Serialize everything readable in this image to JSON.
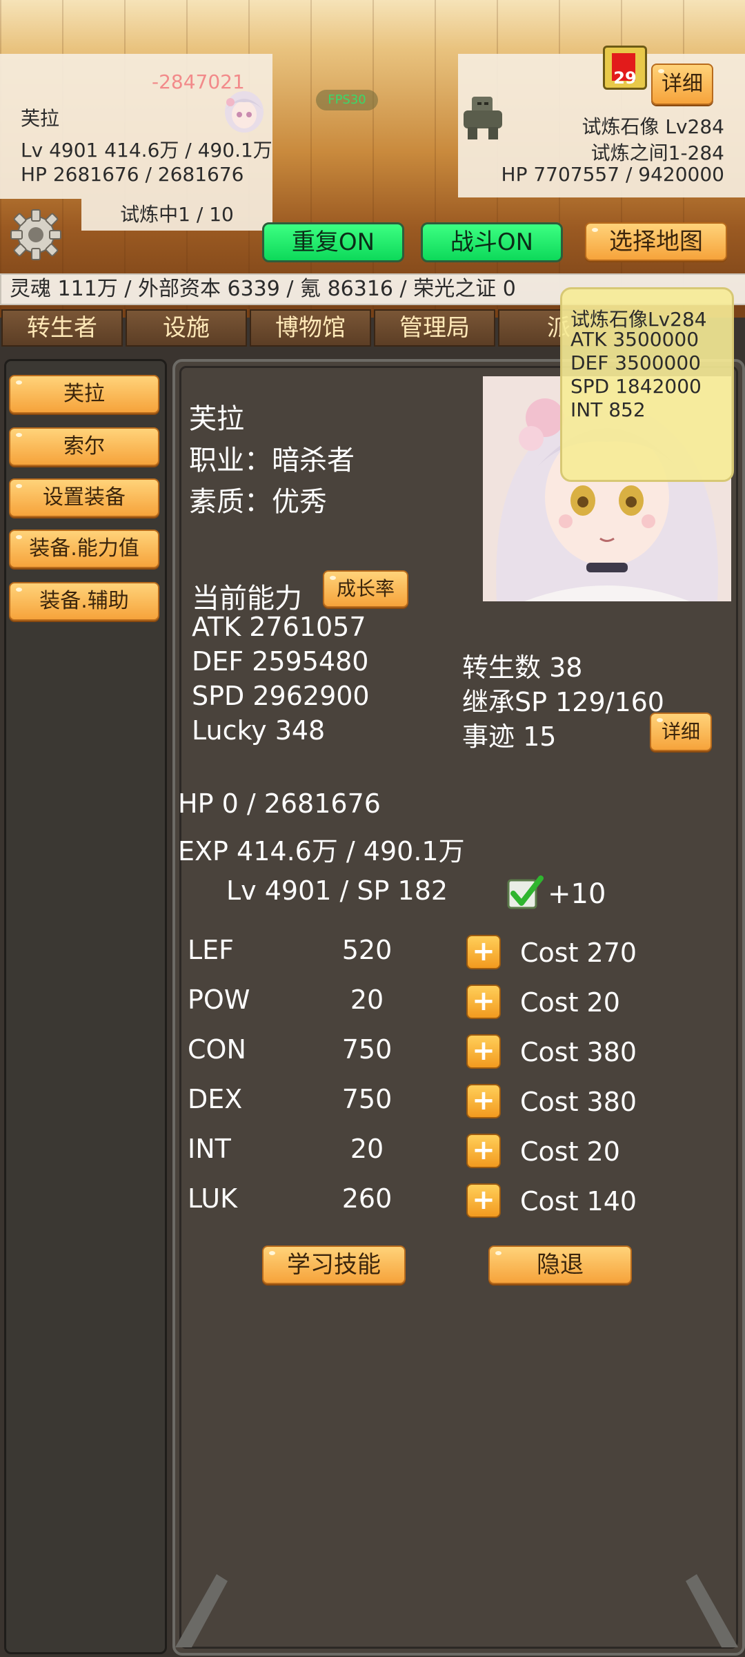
{
  "hud": {
    "fps": "FPS30",
    "damage_float": "-2847021",
    "player": {
      "name": "芙拉",
      "level_exp": "Lv 4901 414.6万 / 490.1万",
      "hp": "HP 2681676 / 2681676",
      "trial_progress": "试炼中1 / 10"
    },
    "enemy": {
      "name_level": "试炼石像 Lv284",
      "location": "试炼之间1-284",
      "hp": "HP 7707557 / 9420000",
      "badge_count": "29",
      "detail_label": "详细"
    }
  },
  "controls": {
    "repeat_label": "重复ON",
    "battle_label": "战斗ON",
    "select_map_label": "选择地图"
  },
  "resources": "灵魂 111万 / 外部资本 6339 / 氪 86316 / 荣光之证 0",
  "tabs": [
    "转生者",
    "设施",
    "博物馆",
    "管理局",
    "派"
  ],
  "enemy_tooltip": {
    "title": "试炼石像Lv284",
    "atk": "ATK 3500000",
    "def": "DEF 3500000",
    "spd": "SPD 1842000",
    "int": "INT 852"
  },
  "sidebar": {
    "items": [
      "芙拉",
      "索尔",
      "设置装备",
      "装备.能力值",
      "装备.辅助"
    ]
  },
  "character": {
    "name": "芙拉",
    "class_line": "职业：暗杀者",
    "quality_line": "素质：优秀",
    "current_ability": "当前能力",
    "growth_rate_label": "成长率",
    "atk": "ATK 2761057",
    "def": "DEF 2595480",
    "spd": "SPD 2962900",
    "lucky": "Lucky 348",
    "rebirth": "转生数 38",
    "inherit_sp": "继承SP 129/160",
    "deeds": "事迹 15",
    "detail_label": "详细",
    "hp": "HP 0 / 2681676",
    "exp": "EXP 414.6万 / 490.1万",
    "level_sp": "Lv 4901 / SP 182",
    "increment": "+10"
  },
  "stats": [
    {
      "name": "LEF",
      "value": "520",
      "cost": "Cost 270"
    },
    {
      "name": "POW",
      "value": "20",
      "cost": "Cost 20"
    },
    {
      "name": "CON",
      "value": "750",
      "cost": "Cost 380"
    },
    {
      "name": "DEX",
      "value": "750",
      "cost": "Cost 380"
    },
    {
      "name": "INT",
      "value": "20",
      "cost": "Cost 20"
    },
    {
      "name": "LUK",
      "value": "260",
      "cost": "Cost 140"
    }
  ],
  "actions": {
    "learn_skill": "学习技能",
    "retire": "隐退"
  },
  "colors": {
    "orange_button": "#f6a33b",
    "green_toggle": "#0dd95a",
    "damage_text": "#f28a8a"
  }
}
